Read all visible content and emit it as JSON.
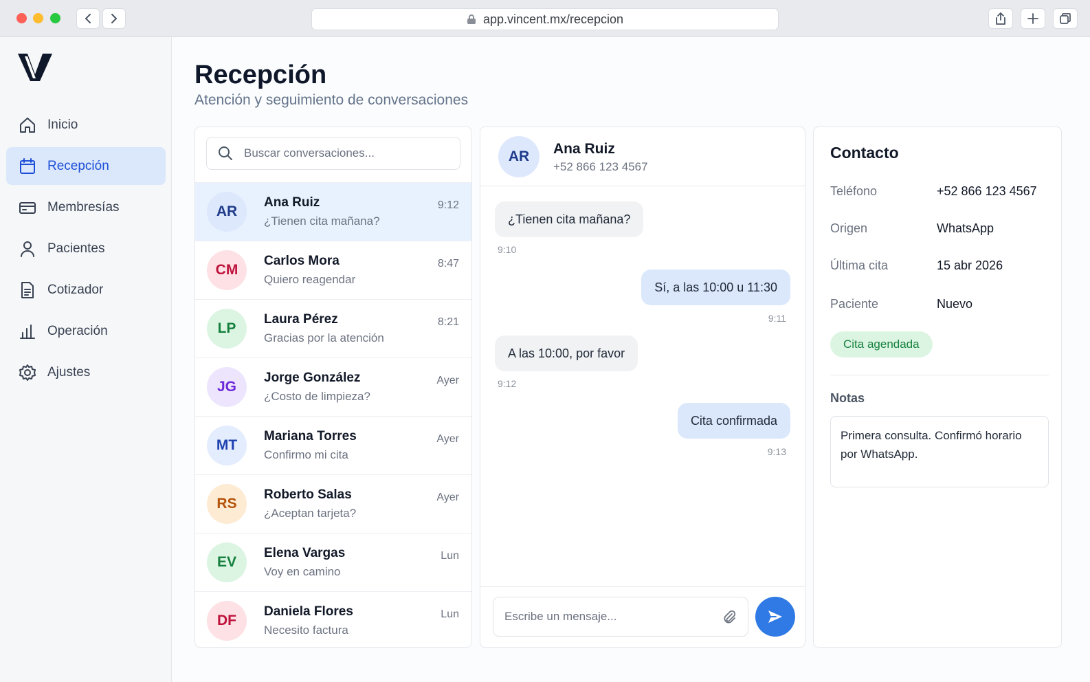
{
  "browser": {
    "url": "app.vincent.mx/recepcion"
  },
  "sidebar": {
    "items": [
      {
        "label": "Inicio",
        "icon": "home-icon"
      },
      {
        "label": "Recepción",
        "icon": "calendar-icon",
        "active": true
      },
      {
        "label": "Membresías",
        "icon": "card-icon"
      },
      {
        "label": "Pacientes",
        "icon": "user-icon"
      },
      {
        "label": "Cotizador",
        "icon": "document-icon"
      },
      {
        "label": "Operación",
        "icon": "bar-chart-icon"
      },
      {
        "label": "Ajustes",
        "icon": "gear-icon"
      }
    ]
  },
  "page": {
    "title": "Recepción",
    "subtitle": "Atención y seguimiento de conversaciones"
  },
  "conversations": {
    "search_placeholder": "Buscar conversaciones...",
    "items": [
      {
        "initials": "AR",
        "name": "Ana Ruiz",
        "message": "¿Tienen cita mañana?",
        "time": "9:12",
        "bg": "#dde8fd",
        "fg": "#1e3a8a"
      },
      {
        "initials": "CM",
        "name": "Carlos Mora",
        "message": "Quiero reagendar",
        "time": "8:47",
        "bg": "#fde1e4",
        "fg": "#be123c"
      },
      {
        "initials": "LP",
        "name": "Laura Pérez",
        "message": "Gracias por la atención",
        "time": "8:21",
        "bg": "#dcf5e3",
        "fg": "#15803d"
      },
      {
        "initials": "JG",
        "name": "Jorge González",
        "message": "¿Costo de limpieza?",
        "time": "Ayer",
        "bg": "#ede5fd",
        "fg": "#6d28d9"
      },
      {
        "initials": "MT",
        "name": "Mariana Torres",
        "message": "Confirmo mi cita",
        "time": "Ayer",
        "bg": "#e3edfd",
        "fg": "#1e40af"
      },
      {
        "initials": "RS",
        "name": "Roberto Salas",
        "message": "¿Aceptan tarjeta?",
        "time": "Ayer",
        "bg": "#fdebd3",
        "fg": "#b45309"
      },
      {
        "initials": "EV",
        "name": "Elena Vargas",
        "message": "Voy en camino",
        "time": "Lun",
        "bg": "#dcf5e3",
        "fg": "#15803d"
      },
      {
        "initials": "DF",
        "name": "Daniela Flores",
        "message": "Necesito factura",
        "time": "Lun",
        "bg": "#fde1e4",
        "fg": "#be123c"
      }
    ]
  },
  "chat": {
    "initials": "AR",
    "name": "Ana Ruiz",
    "phone": "+52 866 123 4567",
    "messages": [
      {
        "text": "¿Tienen cita mañana?",
        "time": "9:10",
        "direction": "in"
      },
      {
        "text": "Sí, a las 10:00 u 11:30",
        "time": "9:11",
        "direction": "out"
      },
      {
        "text": "A las 10:00, por favor",
        "time": "9:12",
        "direction": "in"
      },
      {
        "text": "Cita confirmada",
        "time": "9:13",
        "direction": "out"
      }
    ],
    "input_placeholder": "Escribe un mensaje..."
  },
  "contact": {
    "title": "Contacto",
    "fields": [
      {
        "label": "Teléfono",
        "value": "+52 866 123 4567"
      },
      {
        "label": "Origen",
        "value": "WhatsApp"
      },
      {
        "label": "Última cita",
        "value": "15 abr 2026"
      },
      {
        "label": "Paciente",
        "value": "Nuevo"
      }
    ],
    "badge": "Cita agendada",
    "notes_label": "Notas",
    "notes": "Primera consulta. Confirmó horario por WhatsApp."
  },
  "colors": {
    "accent": "#2f7ae5",
    "active_bg": "#dbe8fb",
    "active_text": "#1d4ed8"
  }
}
